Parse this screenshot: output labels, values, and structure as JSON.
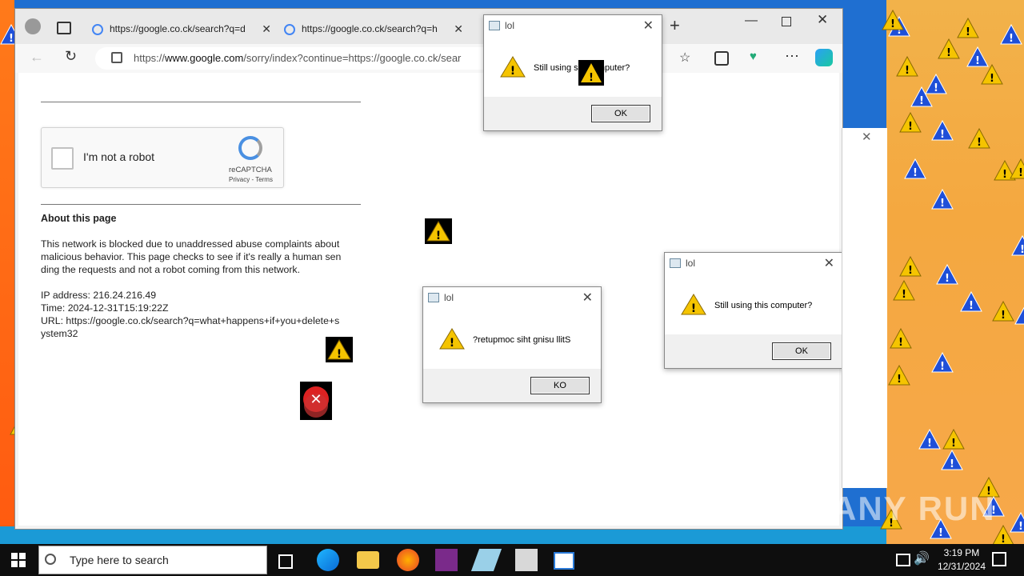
{
  "browser": {
    "tabs": [
      {
        "title": "https://google.co.ck/search?q=d"
      },
      {
        "title": "https://google.co.ck/search?q=h"
      }
    ],
    "url_prefix": "https://",
    "url_host": "www.google.com",
    "url_rest": "/sorry/index?continue=https://google.co.ck/sear"
  },
  "page": {
    "captcha_label": "I'm not a robot",
    "captcha_brand": "reCAPTCHA",
    "captcha_links": "Privacy - Terms",
    "about_heading": "About this page",
    "about_lines": [
      "This network is blocked due to unaddressed abuse complaints about",
      "malicious behavior. This page checks to see if it's really a human sen",
      "ding the requests and not a robot coming from this network."
    ],
    "ip": "IP address: 216.24.216.49",
    "time": "Time: 2024-12-31T15:19:22Z",
    "url_line1": "URL: https://google.co.ck/search?q=what+happens+if+you+delete+s",
    "url_line2": "ystem32"
  },
  "dialogs": [
    {
      "title": "lol",
      "message": "Still using sihT gmputer?",
      "button": "OK"
    },
    {
      "title": "lol",
      "message": "?retupmoc siht gnisu llitS",
      "button": "KO"
    },
    {
      "title": "lol",
      "message": "Still using this computer?",
      "button": "OK"
    }
  ],
  "taskbar": {
    "search_placeholder": "Type here to search",
    "time": "3:19 PM",
    "date": "12/31/2024"
  },
  "watermark": "ANY RUN",
  "colors": {
    "warning": "#f5c400",
    "desktop": "#f4a840",
    "accent": "#1b9ad6"
  }
}
